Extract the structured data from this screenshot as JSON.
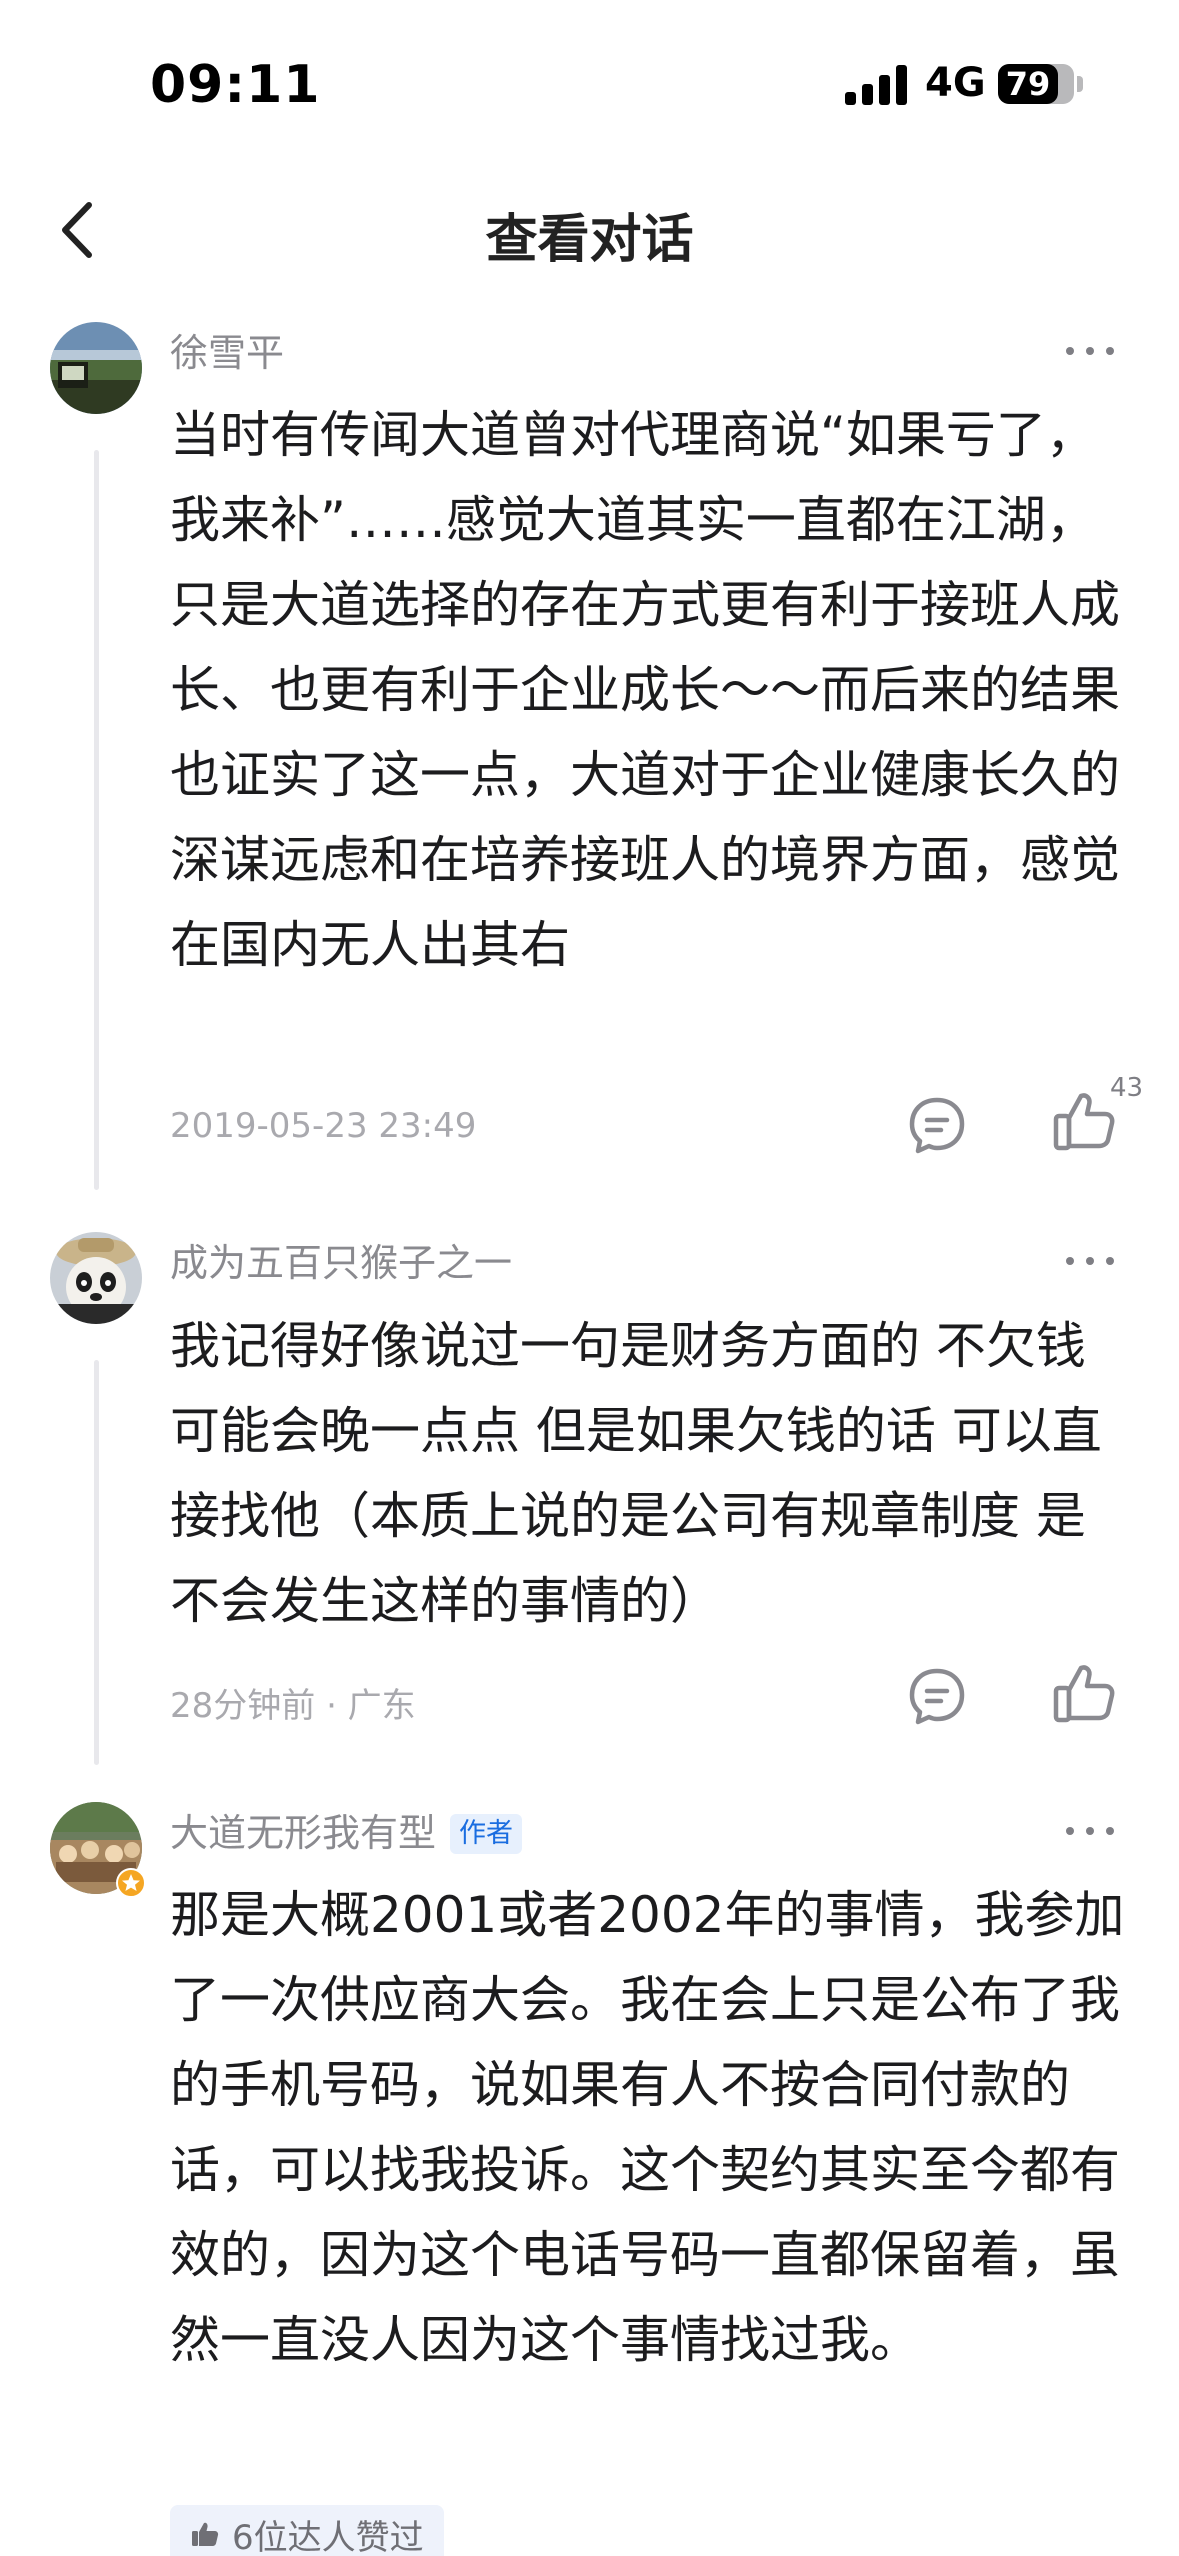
{
  "status_bar": {
    "time": "09:11",
    "network": "4G",
    "battery": "79",
    "battery_level": 0.79
  },
  "nav": {
    "title": "查看对话",
    "back_icon": "chevron-left-icon"
  },
  "comments": [
    {
      "user": "徐雪平",
      "text": "当时有传闻大道曾对代理商说“如果亏了，我来补”……感觉大道其实一直都在江湖，只是大道选择的存在方式更有利于接班人成长、也更有利于企业成长～～而后来的结果也证实了这一点，大道对于企业健康长久的深谋远虑和在培养接班人的境界方面，感觉在国内无人出其右",
      "meta": "2019-05-23 23:49",
      "likes": "43"
    },
    {
      "user": "成为五百只猴子之一",
      "text": "我记得好像说过一句是财务方面的 不欠钱 可能会晚一点点 但是如果欠钱的话 可以直接找他（本质上说的是公司有规章制度 是不会发生这样的事情的）",
      "meta": "28分钟前 · 广东"
    },
    {
      "user": "大道无形我有型",
      "badge": "作者",
      "text": "那是大概2001或者2002年的事情，我参加了一次供应商大会。我在会上只是公布了我的手机号码，说如果有人不按合同付款的话，可以找我投诉。这个契约其实至今都有效的，因为这个电话号码一直都保留着，虽然一直没人因为这个事情找过我。",
      "liked_by": "6位达人赞过"
    }
  ]
}
